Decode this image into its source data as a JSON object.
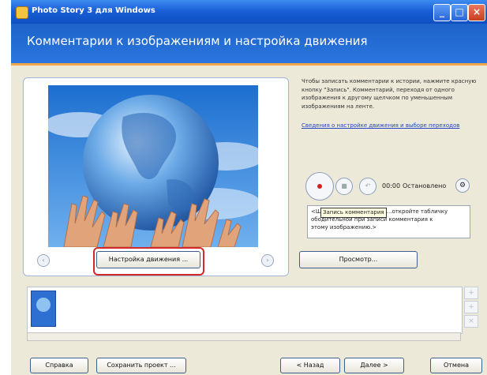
{
  "window": {
    "title": "Photo Story 3 для Windows"
  },
  "header": {
    "title": "Комментарии к изображениям и настройка движения"
  },
  "description": "Чтобы записать комментарии к истории, нажмите красную кнопку \"Запись\". Комментарий, переходя от одного изображения к другому щелчком по уменьшенным изображениям на ленте.",
  "link": "Сведения о настройке движения и выборе переходов",
  "recorder": {
    "time": "00:00",
    "status": "Остановлено"
  },
  "tooltip": "Запись комментария",
  "comment": {
    "placeholder_lines": [
      "<Щ",
      "ободительной при записи комментария к",
      "этому изображению.>"
    ],
    "suffix": "...откройте табличку"
  },
  "buttons": {
    "customize_motion": "Настройка движения ...",
    "preview": "Просмотр...",
    "help": "Справка",
    "save_project": "Сохранить проект ...",
    "back": "< Назад",
    "next": "Далее >",
    "cancel": "Отмена"
  },
  "colors": {
    "header": "#1e63c8",
    "accent": "#f1a74a",
    "highlight": "#d42828"
  }
}
